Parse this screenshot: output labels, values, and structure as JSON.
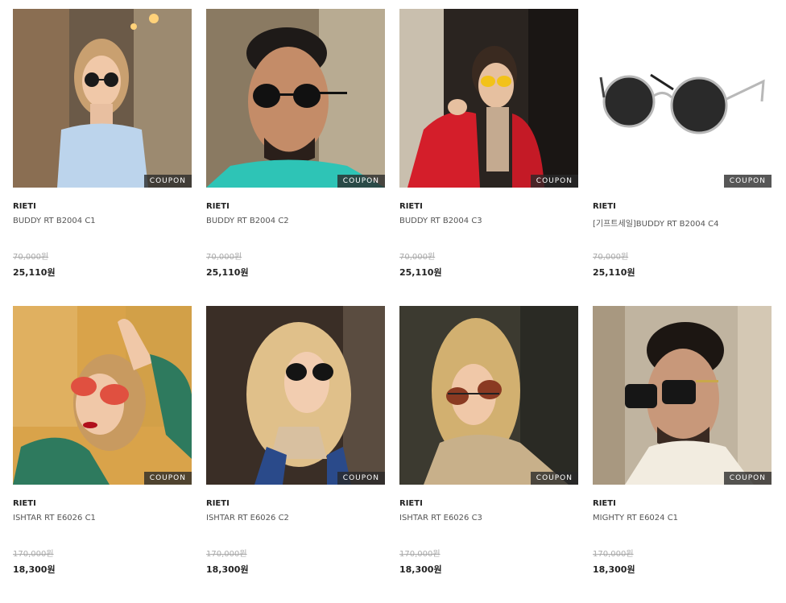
{
  "products": [
    {
      "brand": "RIETI",
      "name": "BUDDY RT B2004 C1",
      "original_price": "70,000원",
      "sale_price": "25,110원",
      "badge": "COUPON",
      "image": "woman-sunglasses-photo"
    },
    {
      "brand": "RIETI",
      "name": "BUDDY RT B2004 C2",
      "original_price": "70,000원",
      "sale_price": "25,110원",
      "badge": "COUPON",
      "image": "man-sunglasses-photo"
    },
    {
      "brand": "RIETI",
      "name": "BUDDY RT B2004 C3",
      "original_price": "70,000원",
      "sale_price": "25,110원",
      "badge": "COUPON",
      "image": "woman-red-jacket-photo"
    },
    {
      "brand": "RIETI",
      "name": "[기프트세일]BUDDY RT B2004 C4",
      "original_price": "70,000원",
      "sale_price": "25,110원",
      "badge": "COUPON",
      "image": "sunglasses-product-photo"
    },
    {
      "brand": "RIETI",
      "name": "ISHTAR RT E6026 C1",
      "original_price": "170,000원",
      "sale_price": "18,300원",
      "badge": "COUPON",
      "image": "woman-green-sweater-photo"
    },
    {
      "brand": "RIETI",
      "name": "ISHTAR RT E6026 C2",
      "original_price": "170,000원",
      "sale_price": "18,300원",
      "badge": "COUPON",
      "image": "blonde-woman-photo"
    },
    {
      "brand": "RIETI",
      "name": "ISHTAR RT E6026 C3",
      "original_price": "170,000원",
      "sale_price": "18,300원",
      "badge": "COUPON",
      "image": "woman-beige-coat-photo"
    },
    {
      "brand": "RIETI",
      "name": "MIGHTY RT E6024 C1",
      "original_price": "170,000원",
      "sale_price": "18,300원",
      "badge": "COUPON",
      "image": "man-turtleneck-photo"
    }
  ]
}
